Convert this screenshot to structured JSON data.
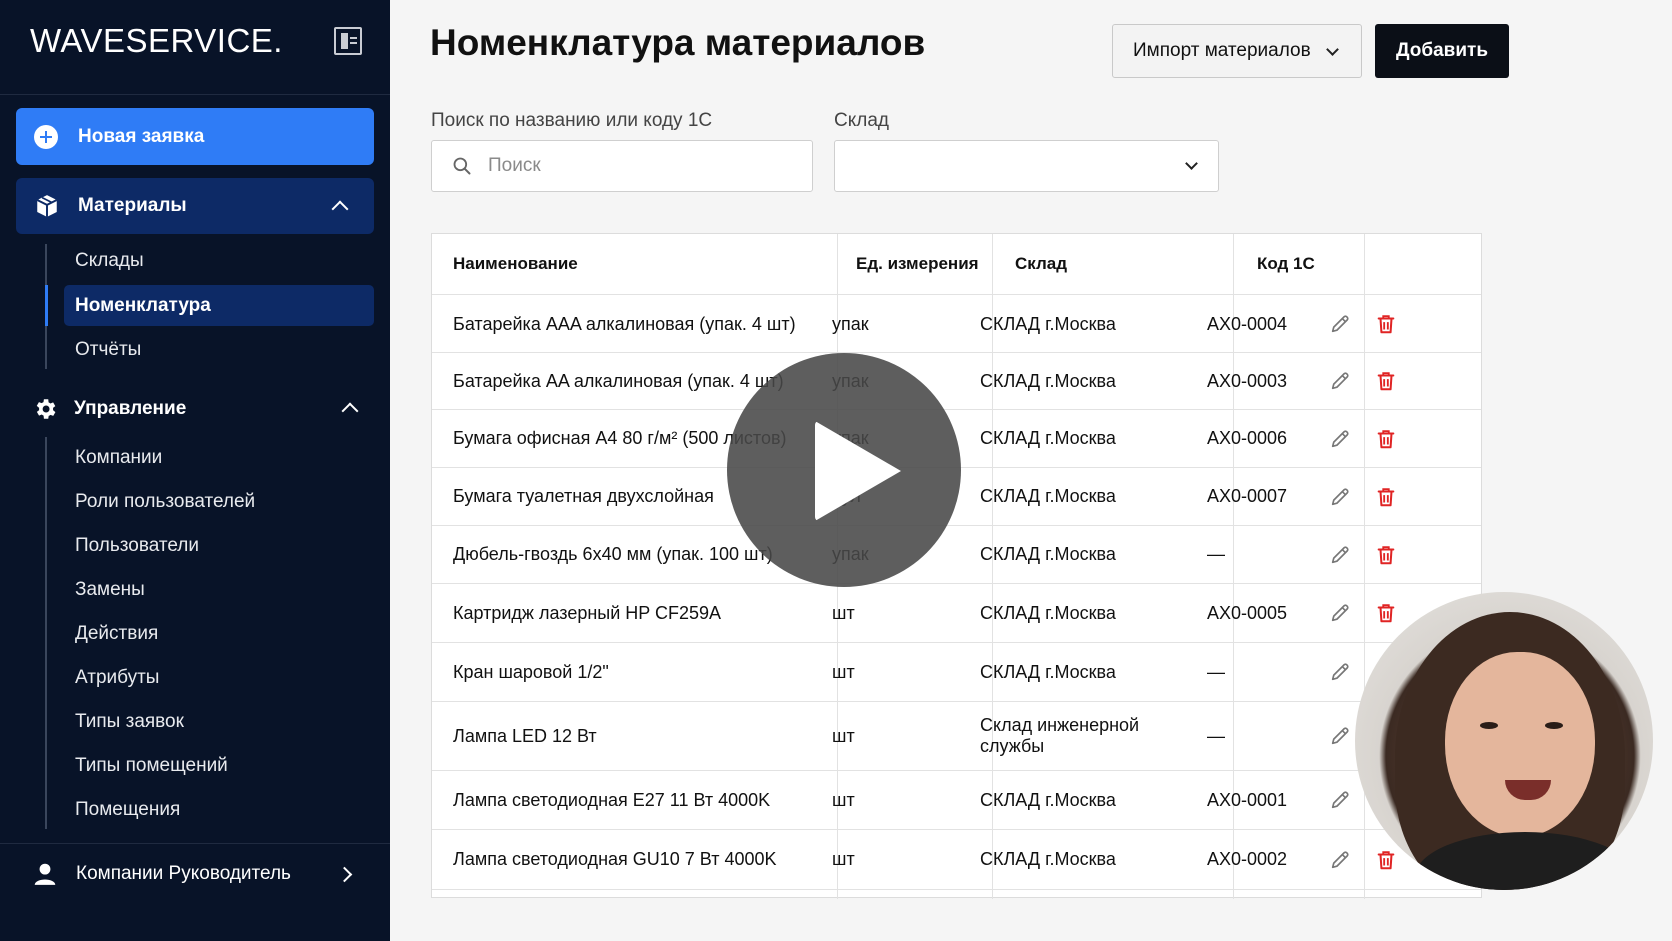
{
  "sidebar": {
    "logo_thin": "WAVE",
    "logo_bold": "SERVICE.",
    "new_request": "Новая заявка",
    "materials": {
      "label": "Материалы",
      "items": [
        {
          "label": "Склады"
        },
        {
          "label": "Номенклатура"
        },
        {
          "label": "Отчёты"
        }
      ]
    },
    "management": {
      "label": "Управление",
      "items": [
        {
          "label": "Компании"
        },
        {
          "label": "Роли пользователей"
        },
        {
          "label": "Пользователи"
        },
        {
          "label": "Замены"
        },
        {
          "label": "Действия"
        },
        {
          "label": "Атрибуты"
        },
        {
          "label": "Типы заявок"
        },
        {
          "label": "Типы помещений"
        },
        {
          "label": "Помещения"
        }
      ]
    },
    "user": "Компании Руководитель"
  },
  "main": {
    "title": "Номенклатура материалов",
    "import_label": "Импорт материалов",
    "add_label": "Добавить",
    "search_label": "Поиск по названию или коду 1С",
    "search_placeholder": "Поиск",
    "warehouse_label": "Склад",
    "warehouse_value": ""
  },
  "table": {
    "headers": [
      "Наименование",
      "Ед. измерения",
      "Склад",
      "Код 1С"
    ],
    "rows": [
      {
        "name": "Батарейка AAA алкалиновая (упак. 4 шт)",
        "unit": "упак",
        "warehouse": "СКЛАД г.Москва",
        "code": "АХ0-0004"
      },
      {
        "name": "Батарейка AA алкалиновая (упак. 4 шт)",
        "unit": "упак",
        "warehouse": "СКЛАД г.Москва",
        "code": "АХ0-0003"
      },
      {
        "name": "Бумага офисная А4 80 г/м² (500 листов)",
        "unit": "упак",
        "warehouse": "СКЛАД г.Москва",
        "code": "АХ0-0006"
      },
      {
        "name": "Бумага туалетная двухслойная",
        "unit": "рул",
        "warehouse": "СКЛАД г.Москва",
        "code": "АХ0-0007"
      },
      {
        "name": "Дюбель-гвоздь 6x40 мм (упак. 100 шт)",
        "unit": "упак",
        "warehouse": "СКЛАД г.Москва",
        "code": "—"
      },
      {
        "name": "Картридж лазерный HP CF259A",
        "unit": "шт",
        "warehouse": "СКЛАД г.Москва",
        "code": "АХ0-0005"
      },
      {
        "name": "Кран шаровой 1/2\"",
        "unit": "шт",
        "warehouse": "СКЛАД г.Москва",
        "code": "—"
      },
      {
        "name": "Лампа LED 12 Вт",
        "unit": "шт",
        "warehouse": "Склад инженерной службы",
        "code": "—"
      },
      {
        "name": "Лампа светодиодная E27 11 Вт 4000K",
        "unit": "шт",
        "warehouse": "СКЛАД г.Москва",
        "code": "АХ0-0001"
      },
      {
        "name": "Лампа светодиодная GU10 7 Вт 4000K",
        "unit": "шт",
        "warehouse": "СКЛАД г.Москва",
        "code": "АХ0-0002"
      }
    ]
  },
  "colors": {
    "sidebar_bg": "#081328",
    "accent": "#2f7cf6",
    "active_bg": "#0d2a66",
    "delete": "#e02424"
  },
  "icons": {
    "edit": "pencil-icon",
    "delete": "trash-icon",
    "search": "search-icon",
    "materials": "box-icon",
    "management": "gear-icon",
    "user": "user-icon"
  }
}
